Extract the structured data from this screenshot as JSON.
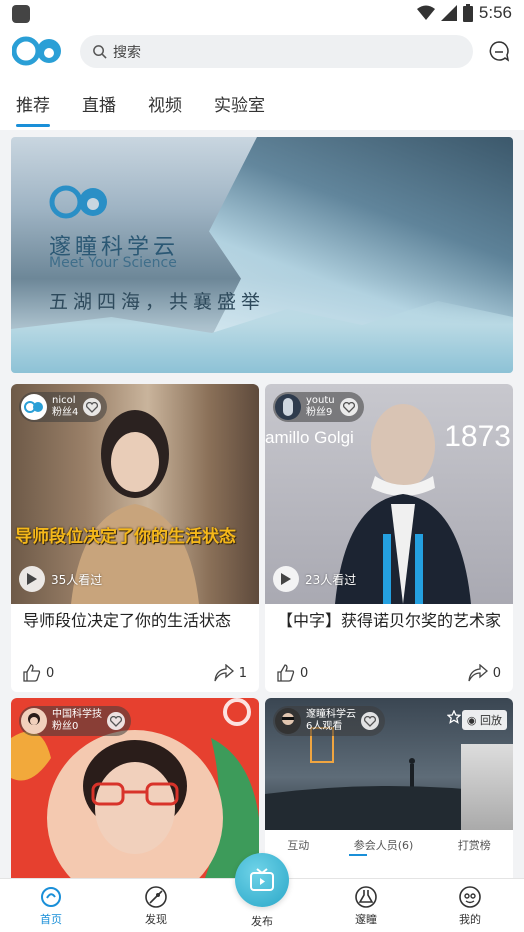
{
  "status_bar": {
    "time": "5:56"
  },
  "header": {
    "search_placeholder": "搜索"
  },
  "tabs": [
    {
      "label": "推荐",
      "active": true
    },
    {
      "label": "直播",
      "active": false
    },
    {
      "label": "视频",
      "active": false
    },
    {
      "label": "实验室",
      "active": false
    }
  ],
  "banner": {
    "title": "邃瞳科学云",
    "subtitle": "Meet Your Science",
    "slogan": "五湖四海，共襄盛举"
  },
  "feed": [
    {
      "user": "nicol",
      "fans": "粉丝4",
      "views": "35人看过",
      "overlay": "导师段位决定了你的生活状态",
      "title": "导师段位决定了你的生活状态",
      "likes": "0",
      "shares": "1"
    },
    {
      "user": "youtu",
      "fans": "粉丝9",
      "views": "23人看过",
      "overlay_name": "amillo Golgi",
      "overlay_year": "1873",
      "title": "【中字】获得诺贝尔奖的艺术家",
      "likes": "0",
      "shares": "0"
    },
    {
      "user": "中国科学技",
      "fans": "粉丝0"
    },
    {
      "user": "邃瞳科学云",
      "fans": "6人观看",
      "replay": "回放",
      "live_tabs": [
        "互动",
        "参会人员(6)",
        "打赏榜"
      ]
    }
  ],
  "bottom_nav": [
    {
      "label": "首页",
      "icon": "home-icon",
      "active": true
    },
    {
      "label": "发现",
      "icon": "discover-icon",
      "active": false
    },
    {
      "label": "发布",
      "icon": "tv-icon",
      "active": false
    },
    {
      "label": "邃瞳",
      "icon": "flask-icon",
      "active": false
    },
    {
      "label": "我的",
      "icon": "profile-icon",
      "active": false
    }
  ],
  "colors": {
    "accent": "#1a8fd8",
    "publish": "#2aa7c8",
    "overlay_text": "#f5b81a"
  }
}
